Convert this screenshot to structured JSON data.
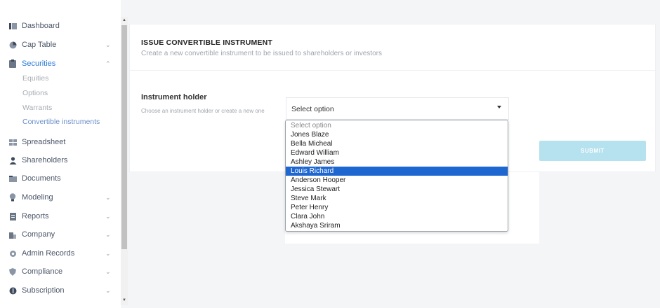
{
  "sidebar": {
    "items": [
      {
        "label": "Dashboard",
        "icon": "dashboard-icon",
        "chevron": ""
      },
      {
        "label": "Cap Table",
        "icon": "pie-chart-icon",
        "chevron": "⌄"
      },
      {
        "label": "Securities",
        "icon": "clipboard-icon",
        "chevron": "⌃"
      },
      {
        "label": "Spreadsheet",
        "icon": "spreadsheet-icon",
        "chevron": ""
      },
      {
        "label": "Shareholders",
        "icon": "person-icon",
        "chevron": ""
      },
      {
        "label": "Documents",
        "icon": "folder-icon",
        "chevron": ""
      },
      {
        "label": "Modeling",
        "icon": "lightbulb-icon",
        "chevron": "⌄"
      },
      {
        "label": "Reports",
        "icon": "report-icon",
        "chevron": "⌄"
      },
      {
        "label": "Company",
        "icon": "building-icon",
        "chevron": "⌄"
      },
      {
        "label": "Admin Records",
        "icon": "gear-icon",
        "chevron": "⌄"
      },
      {
        "label": "Compliance",
        "icon": "shield-icon",
        "chevron": "⌄"
      },
      {
        "label": "Subscription",
        "icon": "dollar-icon",
        "chevron": "⌄"
      }
    ],
    "securities_sub": [
      "Equities",
      "Options",
      "Warrants",
      "Convertible instruments"
    ]
  },
  "card": {
    "title": "ISSUE CONVERTIBLE INSTRUMENT",
    "subtitle": "Create a new convertible instrument to be issued to shareholders or investors",
    "field_label": "Instrument holder",
    "field_help": "Choose an instrument holder or create a new one",
    "select_value": "Select option",
    "submit_label": "SUBMIT"
  },
  "dropdown": {
    "options": [
      "Select option",
      "Jones Blaze",
      "Bella Micheal",
      "Edward William",
      "Ashley James",
      "Louis Richard",
      "Anderson Hooper",
      "Jessica Stewart",
      "Steve Mark",
      "Peter Henry",
      "Clara John",
      "Akshaya Sriram"
    ],
    "highlighted": "Louis Richard"
  },
  "colors": {
    "accent": "#2a7bd6",
    "highlight": "#1e66d0",
    "submit_bg": "#b6e1ef"
  }
}
